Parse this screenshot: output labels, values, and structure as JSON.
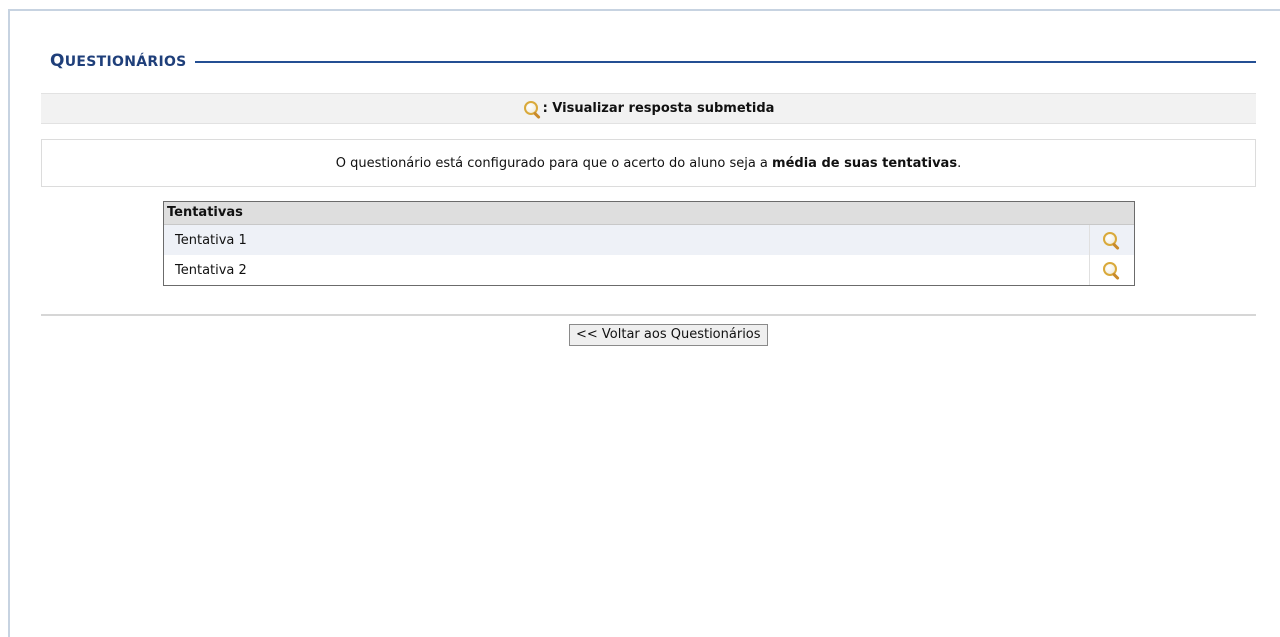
{
  "header": {
    "title_first": "Q",
    "title_rest": "UESTIONÁRIOS"
  },
  "legend": {
    "icon": "magnifier-icon",
    "text": ": Visualizar resposta submetida"
  },
  "info": {
    "text_before": "O questionário está configurado para que o acerto do aluno seja a ",
    "text_bold": "média de suas tentativas",
    "text_after": "."
  },
  "attempts_table": {
    "header": "Tentativas",
    "rows": [
      {
        "label": "Tentativa 1",
        "action_icon": "magnifier-icon"
      },
      {
        "label": "Tentativa 2",
        "action_icon": "magnifier-icon"
      }
    ]
  },
  "actions": {
    "back_label": "<< Voltar aos Questionários"
  },
  "colors": {
    "title": "#1f3f7a",
    "title_line": "#244f93",
    "legend_bg": "#f2f2f2",
    "row_alt_bg": "#eef1f7",
    "icon_gold": "#d9a93a"
  }
}
